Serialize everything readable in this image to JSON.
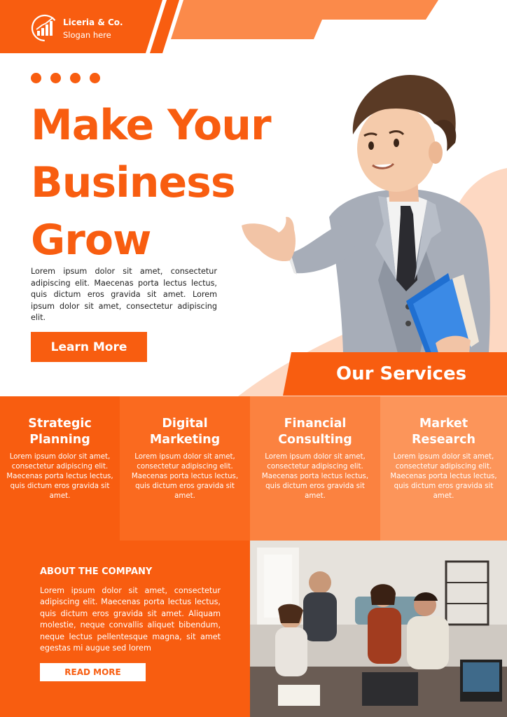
{
  "brand": {
    "name": "Liceria & Co.",
    "slogan": "Slogan here",
    "logo_icon": "bar-chart-growth-icon"
  },
  "colors": {
    "primary": "#f85d10",
    "light": "#fb8240",
    "lighter": "#fc955a",
    "peach": "#fdd7c0",
    "panel_mid": "#fa6a1f"
  },
  "hero": {
    "headline_lines": [
      "Make Your",
      "Business",
      "Grow"
    ],
    "intro": "Lorem ipsum dolor sit amet, consectetur adipiscing elit. Maecenas porta lectus lectus, quis dictum eros gravida sit amet. Lorem ipsum dolor sit amet, consectetur adipiscing elit.",
    "cta_label": "Learn More"
  },
  "services": {
    "title": "Our Services",
    "items": [
      {
        "title_line1": "Strategic",
        "title_line2": "Planning",
        "text": "Lorem ipsum dolor sit amet, consectetur adipiscing elit. Maecenas porta lectus lectus, quis dictum eros gravida sit amet."
      },
      {
        "title_line1": "Digital",
        "title_line2": "Marketing",
        "text": "Lorem ipsum dolor sit amet, consectetur adipiscing elit. Maecenas porta lectus lectus, quis dictum eros gravida sit amet."
      },
      {
        "title_line1": "Financial",
        "title_line2": "Consulting",
        "text": "Lorem ipsum dolor sit amet, consectetur adipiscing elit. Maecenas porta lectus lectus, quis dictum eros gravida sit amet."
      },
      {
        "title_line1": "Market",
        "title_line2": "Research",
        "text": "Lorem ipsum dolor sit amet, consectetur adipiscing elit. Maecenas porta lectus lectus, quis dictum eros gravida sit amet."
      }
    ]
  },
  "about": {
    "title": "ABOUT THE COMPANY",
    "text": "Lorem ipsum dolor sit amet, consectetur adipiscing elit. Maecenas porta lectus lectus, quis dictum eros gravida sit amet. Aliquam molestie, neque convallis aliquet bibendum, neque lectus pellentesque magna, sit amet egestas mi augue sed lorem",
    "button_label": "READ MORE"
  }
}
